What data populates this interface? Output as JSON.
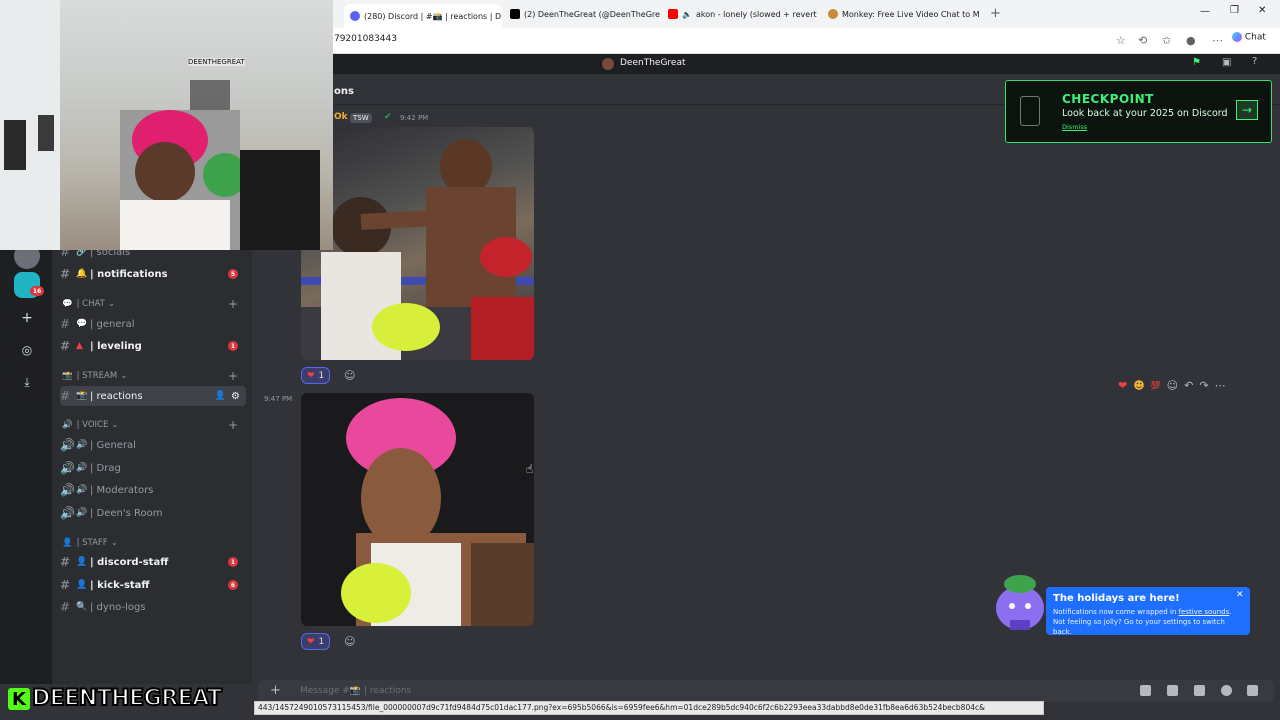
{
  "browser": {
    "tabs": [
      {
        "label": "(280) Discord | #📸 | reactions | D",
        "icon": "discord-icon"
      },
      {
        "label": "(2) DeenTheGreat (@DeenTheGre",
        "icon": "x-icon"
      },
      {
        "label": "akon - lonely (slowed + revert",
        "icon": "youtube-icon"
      },
      {
        "label": "Monkey: Free Live Video Chat to M",
        "icon": "monkey-icon"
      }
    ],
    "url": "79201083443",
    "chat_label": "Chat"
  },
  "discord": {
    "server_name": "DeenTheGreat",
    "rail_badge": "16",
    "categories": [
      {
        "label": "| CHAT",
        "id": "chat"
      },
      {
        "label": "| STREAM",
        "id": "stream"
      },
      {
        "label": "| VOICE",
        "id": "voice"
      },
      {
        "label": "| STAFF",
        "id": "staff"
      }
    ],
    "channels": {
      "socials": "| socials",
      "notifications": "| notifications",
      "notifications_badge": "5",
      "general": "| general",
      "leveling": "| leveling",
      "leveling_badge": "1",
      "reactions": "| reactions",
      "voice_general": "| General",
      "voice_drag": "| Drag",
      "voice_moderators": "| Moderators",
      "voice_deens_room": "| Deen's Room",
      "discord_staff": "| discord-staff",
      "discord_staff_badge": "1",
      "kick_staff": "| kick-staff",
      "kick_staff_badge": "6",
      "dyno_logs": "| dyno-logs"
    },
    "header_fragment": "ons",
    "message": {
      "author": "Ok",
      "tag": "TSW",
      "time1": "9:42 PM",
      "time2": "9:47 PM",
      "reaction1_count": "1",
      "reaction2_count": "1"
    },
    "checkpoint": {
      "title": "CHECKPOINT",
      "subtitle": "Look back at your 2025 on Discord",
      "dismiss": "Dismiss"
    },
    "holiday": {
      "title": "The holidays are here!",
      "text_before": "Notifications now come wrapped in ",
      "link": "festive sounds",
      "text_after": ". Not feeling so jolly? Go to your settings to switch back."
    },
    "composer_placeholder": "Message #📸 | reactions"
  },
  "status_url": "443/1457249010573115453/file_000000007d9c71fd9484d75c01dac177.png?ex=695b5066&is=6959fee6&hm=01dce289b5dc940c6f2c6b2293eea33dabbd8e0de31fb8ea6d63b524becb804c&",
  "stream_overlay": {
    "brand_k": "K",
    "brand_text": "DEENTHEGREAT",
    "webcam_sign": "DEENTHEGREAT"
  },
  "colors": {
    "discord_bg": "#313338",
    "channel_bg": "#2b2d31",
    "rail_bg": "#1e1f22",
    "accent_green": "#3cf07a",
    "kick_green": "#53fc18",
    "badge_red": "#da373c",
    "holiday_blue": "#1e6fff"
  }
}
